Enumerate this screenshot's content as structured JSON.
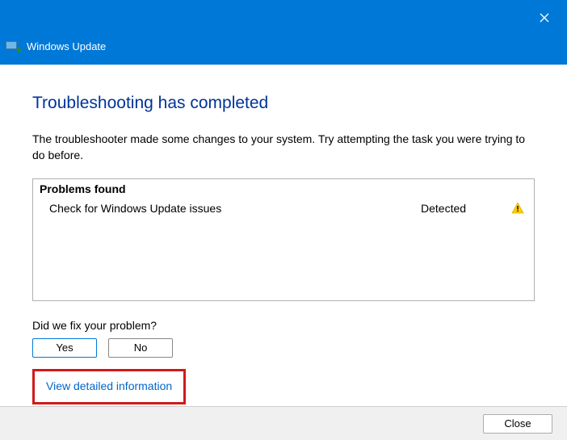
{
  "header": {
    "title": "Windows Update"
  },
  "main": {
    "heading": "Troubleshooting has completed",
    "description": "The troubleshooter made some changes to your system. Try attempting the task you were trying to do before."
  },
  "problems": {
    "header": "Problems found",
    "items": [
      {
        "name": "Check for Windows Update issues",
        "status": "Detected"
      }
    ]
  },
  "feedback": {
    "question": "Did we fix your problem?",
    "yes": "Yes",
    "no": "No"
  },
  "links": {
    "view_detailed": "View detailed information"
  },
  "footer": {
    "close": "Close"
  }
}
